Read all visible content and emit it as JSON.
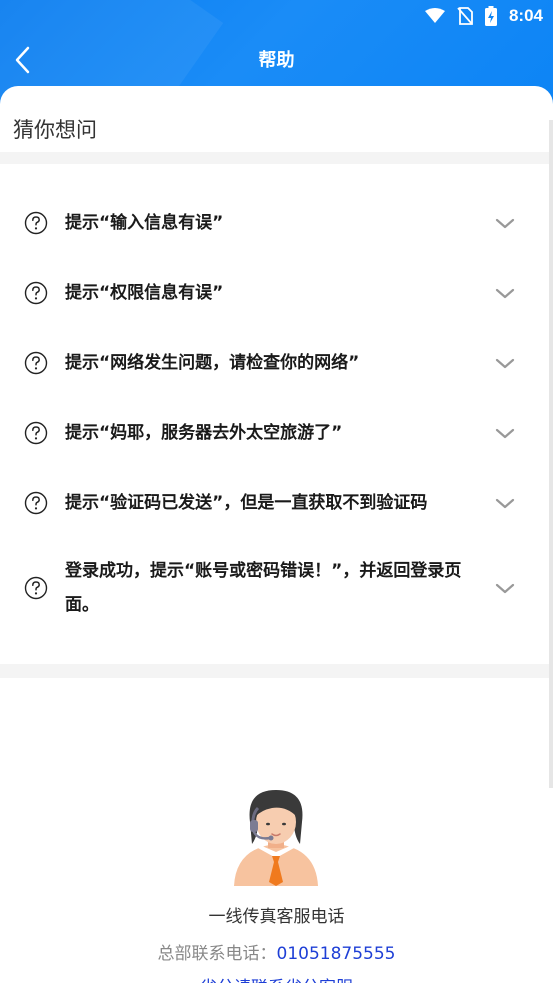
{
  "status_bar": {
    "time": "8:04"
  },
  "nav": {
    "title": "帮助"
  },
  "section": {
    "title": "猜你想问"
  },
  "faq": [
    {
      "text": "提示“输入信息有误”"
    },
    {
      "text": "提示“权限信息有误”"
    },
    {
      "text": "提示“网络发生问题，请检查你的网络”"
    },
    {
      "text": "提示“妈耶，服务器去外太空旅游了”"
    },
    {
      "text": "提示“验证码已发送”，但是一直获取不到验证码"
    },
    {
      "text": "登录成功，提示“账号或密码错误！”，并返回登录页面。"
    }
  ],
  "contact": {
    "title": "一线传真客服电话",
    "hq_label": "总部联系电话：",
    "hq_phone": "01051875555",
    "branch_text": "省分请联系省分客服"
  },
  "colors": {
    "header_blue": "#0c84f5",
    "link_blue": "#1e3fd6"
  }
}
